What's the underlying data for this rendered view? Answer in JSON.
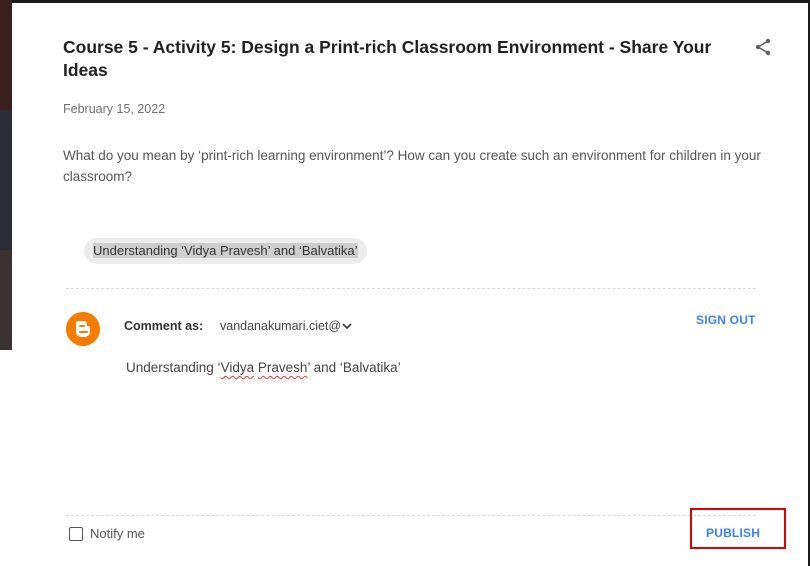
{
  "post": {
    "title": "Course 5 - Activity 5: Design a Print-rich Classroom Environment - Share Your Ideas",
    "date": "February 15, 2022",
    "body": "What do you mean by ‘print-rich learning environment’? How can you create such an environment for children in your classroom?",
    "quote": "Understanding ‘Vidya Pravesh’ and ‘Balvatika’"
  },
  "comment": {
    "comment_as_label": "Comment as:",
    "account": "vandanakumari.ciet@",
    "sign_out_label": "SIGN OUT",
    "text_prefix": "Understanding ‘",
    "text_misspelled_1": "Vidya",
    "text_space": " ",
    "text_misspelled_2": "Pravesh",
    "text_suffix": "’ and ‘Balvatika’",
    "notify_label": "Notify me",
    "notify_checked": false,
    "publish_label": "PUBLISH"
  },
  "icons": {
    "share": "share-icon",
    "avatar": "blogger-logo-icon",
    "chevron": "chevron-down-icon"
  },
  "colors": {
    "accent": "#3b82f6",
    "blogger_orange": "#f57c00",
    "highlight_border": "#e00000"
  }
}
